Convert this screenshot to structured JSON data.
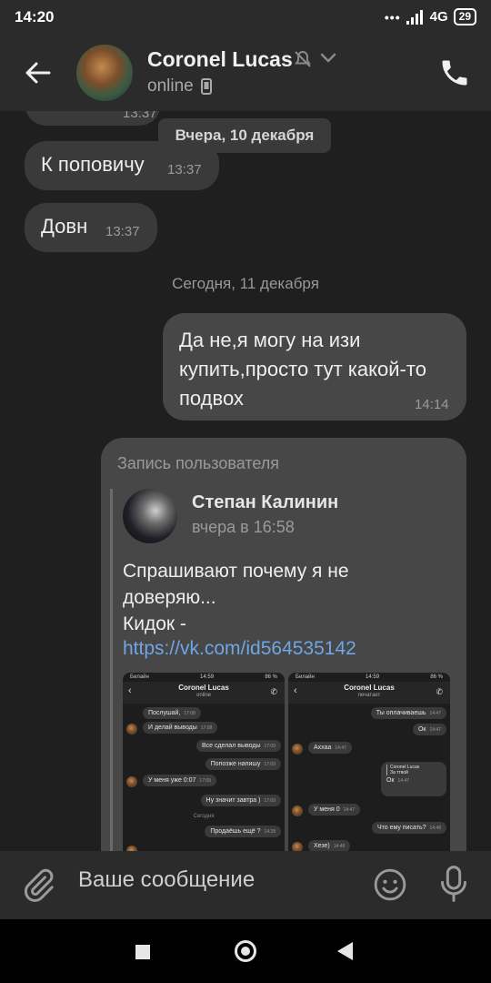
{
  "status_bar": {
    "time": "14:20",
    "network": "4G",
    "battery": "29"
  },
  "header": {
    "contact_name": "Coronel Lucas",
    "status": "online"
  },
  "chat": {
    "partial_message": {
      "time": "13:37"
    },
    "float_date": "Вчера, 10 декабря",
    "messages_in": [
      {
        "text": "К поповичу",
        "time": "13:37"
      },
      {
        "text": "Довн",
        "time": "13:37"
      }
    ],
    "date_separator": "Сегодня, 11 декабря",
    "message_out": {
      "line1": "Да не,я могу на изи",
      "line2": "купить,просто тут какой-то",
      "line3": "подвох",
      "time": "14:14"
    },
    "repost": {
      "label": "Запись пользователя",
      "author": "Степан Калинин",
      "date": "вчера в 16:58",
      "text_line1": "Спрашивают почему я не",
      "text_line2": "доверяю...",
      "text_line3": "Кидок -",
      "link": "https://vk.com/id564535142",
      "screenshot_left": {
        "carrier": "Билайн",
        "time": "14:59",
        "battery": "86 %",
        "name": "Coronel Lucas",
        "status": "online",
        "messages": [
          {
            "text": "Послушай,",
            "time": "17:08"
          },
          {
            "text": "И делай выводы",
            "time": "17:08"
          },
          {
            "text": "Все сделал выводы",
            "time": "17:09"
          },
          {
            "text": "Попозже напишу",
            "time": "17:09"
          },
          {
            "text": "У меня уже 0:07",
            "time": "17:09"
          },
          {
            "text": "Ну значит завтра )",
            "time": "17:09"
          },
          {
            "text": "Продаёшь ещё ?",
            "time": "14:28"
          }
        ],
        "date_sep": "Сегодня"
      },
      "screenshot_right": {
        "carrier": "Билайн",
        "time": "14:59",
        "battery": "86 %",
        "name": "Coronel Lucas",
        "status": "печатает",
        "messages": [
          {
            "text": "Ты оплачиваешь",
            "time": "14:47"
          },
          {
            "text": "Ок",
            "time": "14:47"
          },
          {
            "text": "Аххаа",
            "time": "14:47"
          },
          {
            "text": "Coronel Lucas",
            "time": ""
          },
          {
            "text": "За ттвой",
            "time": ""
          },
          {
            "text": "Ок",
            "time": "14:47"
          },
          {
            "text": "У меня 0",
            "time": "14:47"
          },
          {
            "text": "Что ему писать?",
            "time": "14:48"
          },
          {
            "text": "Хезе)",
            "time": "14:48"
          }
        ]
      }
    }
  },
  "input": {
    "placeholder": "Ваше сообщение"
  },
  "colors": {
    "background": "#1f1f1f",
    "bubble_in": "#3a3a3a",
    "bubble_out": "#474747",
    "link": "#6ea6e6"
  }
}
